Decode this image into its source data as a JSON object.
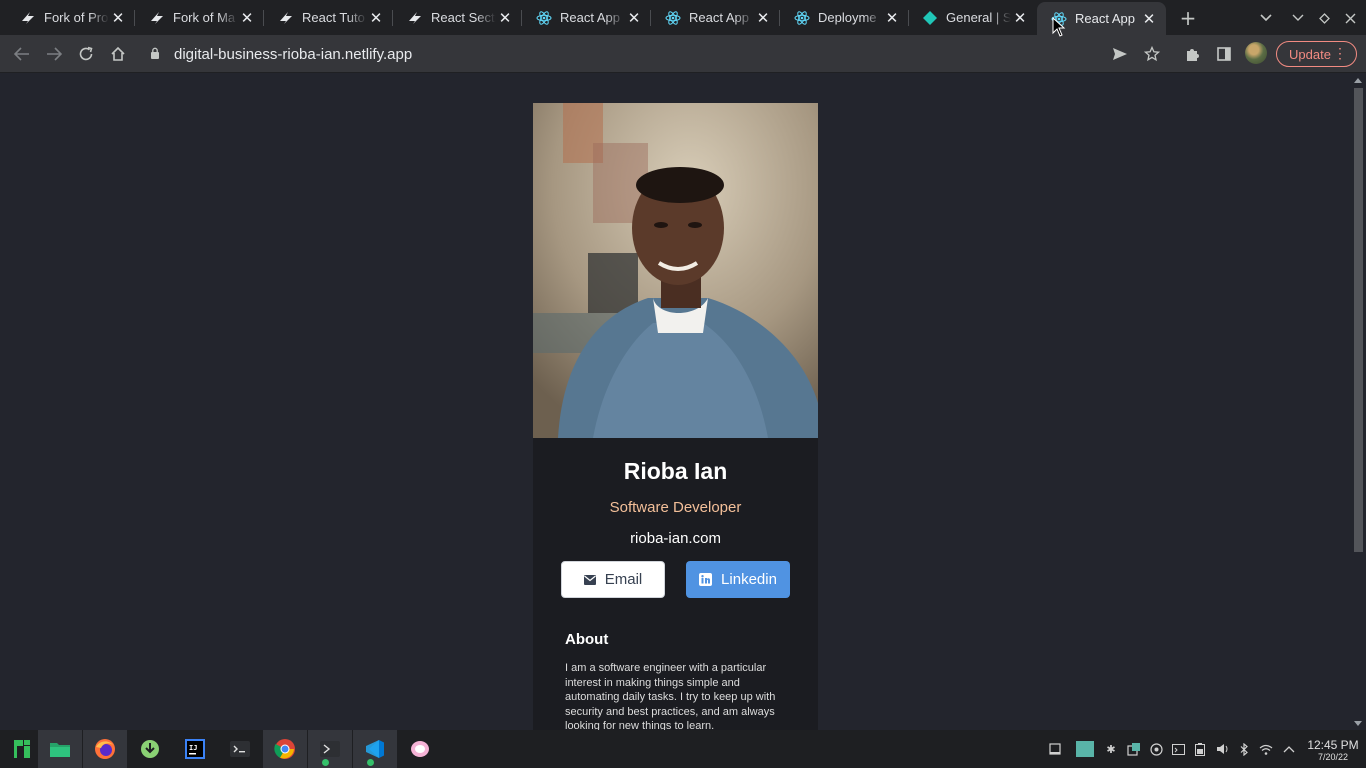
{
  "browser": {
    "tabs": [
      {
        "title": "Fork of Pro",
        "favicon": "stackblitz-icon"
      },
      {
        "title": "Fork of Ma",
        "favicon": "stackblitz-icon"
      },
      {
        "title": "React Tuto",
        "favicon": "stackblitz-icon"
      },
      {
        "title": "React Secti",
        "favicon": "stackblitz-icon"
      },
      {
        "title": "React App",
        "favicon": "react-icon"
      },
      {
        "title": "React App",
        "favicon": "react-icon"
      },
      {
        "title": "Deployme",
        "favicon": "react-icon"
      },
      {
        "title": "General | S",
        "favicon": "netlify-icon"
      },
      {
        "title": "React App",
        "favicon": "react-icon",
        "active": true
      }
    ],
    "url": "digital-business-rioba-ian.netlify.app",
    "update_label": "Update"
  },
  "profile": {
    "name": "Rioba Ian",
    "role": "Software Developer",
    "website": "rioba-ian.com",
    "email_label": "Email",
    "linkedin_label": "Linkedin",
    "about_heading": "About",
    "about_text": "I am a software engineer with a particular interest in making things simple and automating daily tasks. I try to keep up with security and best practices, and am always looking for new things to learn."
  },
  "taskbar": {
    "time": "12:45 PM",
    "date": "7/20/22",
    "apps": [
      "manjaro-icon",
      "files-icon",
      "firefox-icon",
      "download-icon",
      "intellij-icon",
      "terminal-icon",
      "chrome-icon",
      "terminal-icon",
      "vscode-icon",
      "bubble-icon"
    ]
  },
  "colors": {
    "page_bg": "#23252d",
    "card_bg": "#1b1c21",
    "role_accent": "#f3bf99",
    "linkedin_blue": "#5093e2",
    "update_red": "#f28b82"
  }
}
